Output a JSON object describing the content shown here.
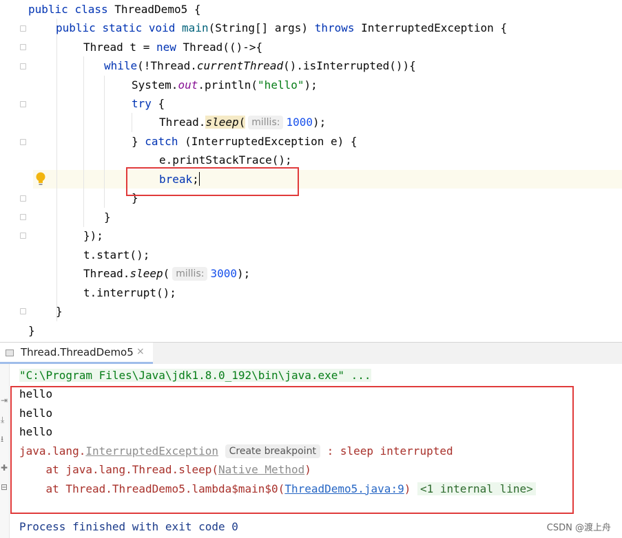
{
  "editor": {
    "lines": {
      "l1": {
        "kw1": "public",
        "kw2": "class",
        "name": "ThreadDemo5",
        "brace": "{"
      },
      "l2": {
        "kw1": "public",
        "kw2": "static",
        "kw3": "void",
        "method": "main",
        "args": "(String[] args)",
        "throws": "throws",
        "ex": "InterruptedException",
        "brace": "{"
      },
      "l3": {
        "type": "Thread t =",
        "new": "new",
        "rest": "Thread(()->{"
      },
      "l4": {
        "kw": "while",
        "a": "(!Thread.",
        "b": "currentThread",
        "c": "().isInterrupted()){"
      },
      "l5": {
        "a": "System.",
        "out": "out",
        "b": ".println(",
        "str": "\"hello\"",
        "c": ");"
      },
      "l6": {
        "kw": "try",
        "brace": "{"
      },
      "l7": {
        "a": "Thread.",
        "sleep": "sleep",
        "paren": "(",
        "hint": "millis:",
        "num": "1000",
        "end": ");"
      },
      "l8": {
        "close": "}",
        "kw": "catch",
        "rest": "(InterruptedException e) {"
      },
      "l9": {
        "text": "e.printStackTrace();"
      },
      "l10": {
        "kw": "break",
        "semi": ";"
      },
      "l11": {
        "text": "}"
      },
      "l12": {
        "text": "}"
      },
      "l13": {
        "text": "});"
      },
      "l14": {
        "text": "t.start();"
      },
      "l15": {
        "a": "Thread.",
        "sleep": "sleep",
        "paren": "(",
        "hint": "millis:",
        "num": "3000",
        "end": ");"
      },
      "l16": {
        "text": "t.interrupt();"
      },
      "l17": {
        "text": "}"
      },
      "l18": {
        "text": "}"
      }
    }
  },
  "run_panel": {
    "tab_label": "Thread.ThreadDemo5",
    "tab_close": "×"
  },
  "console": {
    "cmd": "\"C:\\Program Files\\Java\\jdk1.8.0_192\\bin\\java.exe\" ...",
    "out": [
      "hello",
      "hello",
      "hello"
    ],
    "exception": {
      "pkg": "java.lang.",
      "cls": "InterruptedException",
      "breakpoint": "Create breakpoint",
      "msg": ": sleep interrupted"
    },
    "trace1": {
      "prefix": "at java.lang.Thread.sleep(",
      "link": "Native Method",
      "suffix": ")"
    },
    "trace2": {
      "prefix": "at Thread.ThreadDemo5.lambda$main$0(",
      "link": "ThreadDemo5.java:9",
      "suffix": ")",
      "internal": "<1 internal line>"
    },
    "exit": "Process finished with exit code 0"
  },
  "watermark": "CSDN @渡上舟",
  "colors": {
    "highlight_box": "#e03a3a",
    "keyword": "#0033b3",
    "string": "#067d17",
    "number": "#1750eb"
  }
}
